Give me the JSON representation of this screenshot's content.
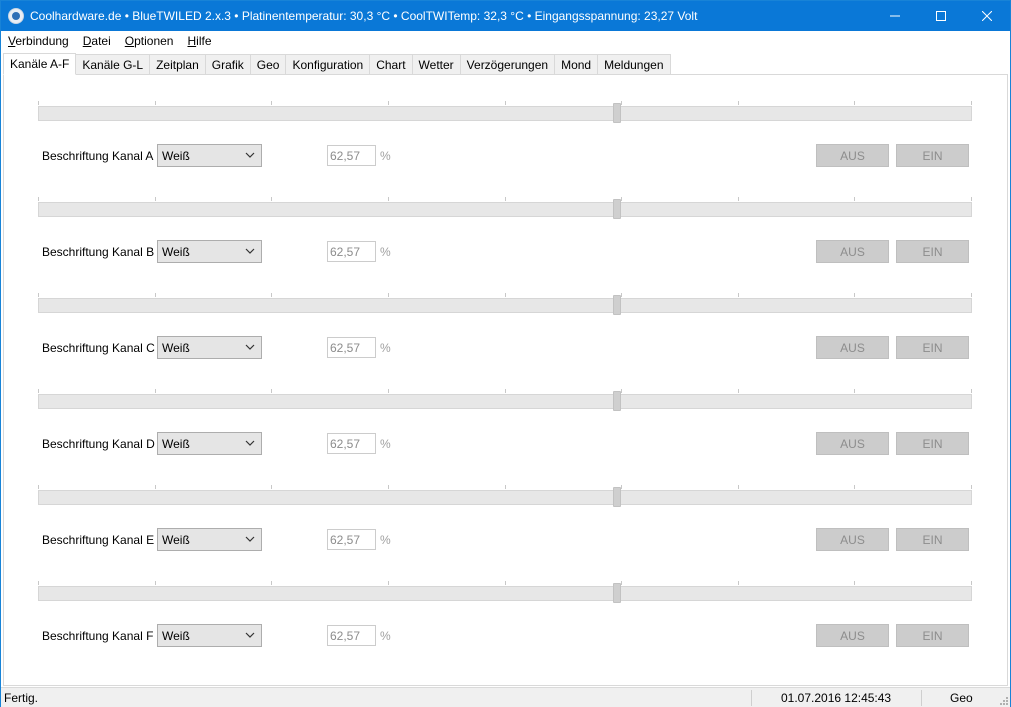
{
  "window": {
    "title": "Coolhardware.de • BlueTWILED 2.x.3 • Platinentemperatur: 30,3 °C • CoolTWITemp: 32,3 °C • Eingangsspannung: 23,27 Volt",
    "icon": "app-globe-icon",
    "controls": {
      "minimize": "minimize-icon",
      "maximize": "maximize-icon",
      "close": "close-icon"
    }
  },
  "menu": {
    "items": [
      {
        "first": "V",
        "rest": "erbindung"
      },
      {
        "first": "D",
        "rest": "atei"
      },
      {
        "first": "O",
        "rest": "ptionen"
      },
      {
        "first": "H",
        "rest": "ilfe"
      }
    ]
  },
  "tabs": [
    {
      "label": "Kanäle A-F",
      "active": true
    },
    {
      "label": "Kanäle G-L",
      "active": false
    },
    {
      "label": "Zeitplan",
      "active": false
    },
    {
      "label": "Grafik",
      "active": false
    },
    {
      "label": "Geo",
      "active": false
    },
    {
      "label": "Konfiguration",
      "active": false
    },
    {
      "label": "Chart",
      "active": false
    },
    {
      "label": "Wetter",
      "active": false
    },
    {
      "label": "Verzögerungen",
      "active": false
    },
    {
      "label": "Mond",
      "active": false
    },
    {
      "label": "Meldungen",
      "active": false
    }
  ],
  "channels": [
    {
      "label": "Beschriftung Kanal A",
      "color": "Weiß",
      "value": "62,57",
      "unit": "%",
      "slider_fraction": 0.62,
      "off_label": "AUS",
      "on_label": "EIN"
    },
    {
      "label": "Beschriftung Kanal B",
      "color": "Weiß",
      "value": "62,57",
      "unit": "%",
      "slider_fraction": 0.62,
      "off_label": "AUS",
      "on_label": "EIN"
    },
    {
      "label": "Beschriftung Kanal C",
      "color": "Weiß",
      "value": "62,57",
      "unit": "%",
      "slider_fraction": 0.62,
      "off_label": "AUS",
      "on_label": "EIN"
    },
    {
      "label": "Beschriftung Kanal D",
      "color": "Weiß",
      "value": "62,57",
      "unit": "%",
      "slider_fraction": 0.62,
      "off_label": "AUS",
      "on_label": "EIN"
    },
    {
      "label": "Beschriftung Kanal E",
      "color": "Weiß",
      "value": "62,57",
      "unit": "%",
      "slider_fraction": 0.62,
      "off_label": "AUS",
      "on_label": "EIN"
    },
    {
      "label": "Beschriftung Kanal F",
      "color": "Weiß",
      "value": "62,57",
      "unit": "%",
      "slider_fraction": 0.62,
      "off_label": "AUS",
      "on_label": "EIN"
    }
  ],
  "status": {
    "text": "Fertig.",
    "datetime": "01.07.2016 12:45:43",
    "mode": "Geo"
  },
  "colors": {
    "titlebar": "#0a78d7",
    "button_disabled": "#cccccc",
    "track": "#e7e7e7"
  }
}
